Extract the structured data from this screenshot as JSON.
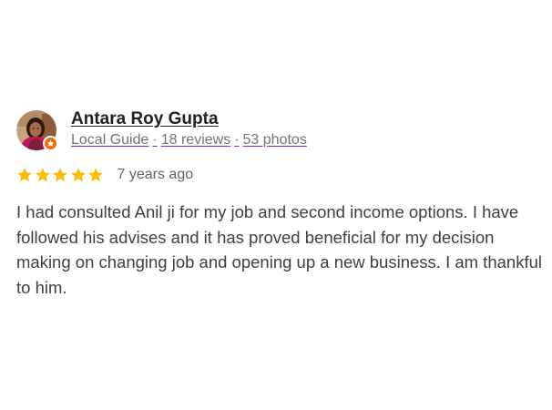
{
  "reviewer": {
    "name": "Antara Roy Gupta",
    "level": "Local Guide",
    "separator": "·",
    "reviews": "18 reviews",
    "photos": "53 photos"
  },
  "rating": {
    "stars": 5,
    "max_stars": 5,
    "time_ago": "7 years ago",
    "star_color": "#fbbc04"
  },
  "review_text": "I had consulted Anil ji for my job and second income options. I have followed his advises and it has proved beneficial for my decision making on changing job and opening up a new business. I am thankful to him.",
  "icons": {
    "avatar": "profile-photo",
    "badge": "local-guide-star-badge",
    "rating": "star-icon"
  },
  "colors": {
    "badge": "#e8710a",
    "text": "#3c4043",
    "meta": "#70757a"
  }
}
